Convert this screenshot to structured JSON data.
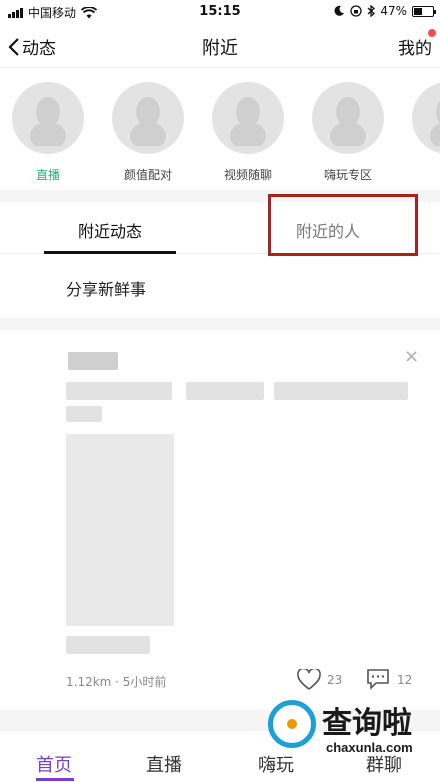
{
  "status_bar": {
    "carrier": "中国移动",
    "time": "15:15",
    "battery": "47%",
    "battery_level": 0.47
  },
  "nav": {
    "back_label": "动态",
    "title": "附近",
    "right_label": "我的"
  },
  "shortcuts": [
    {
      "label": "直播",
      "active": true
    },
    {
      "label": "颜值配对",
      "active": false
    },
    {
      "label": "视频随聊",
      "active": false
    },
    {
      "label": "嗨玩专区",
      "active": false
    },
    {
      "label": "狼",
      "active": false
    }
  ],
  "tabs": {
    "active": "附近动态",
    "inactive": "附近的人"
  },
  "share_label": "分享新鲜事",
  "post": {
    "close": "×",
    "distance_time": "1.12km · 5小时前",
    "likes": "23",
    "comments": "12"
  },
  "tab_bar": {
    "home": "首页",
    "live": "直播",
    "play": "嗨玩",
    "chat": "群聊"
  },
  "watermark": {
    "text": "查询啦",
    "domain": "chaxunla.com"
  },
  "colors": {
    "accent_purple": "#7a3fd1",
    "live_green": "#2ab07a",
    "highlight_red": "#a8231e",
    "notification_red": "#ff4a4a"
  }
}
